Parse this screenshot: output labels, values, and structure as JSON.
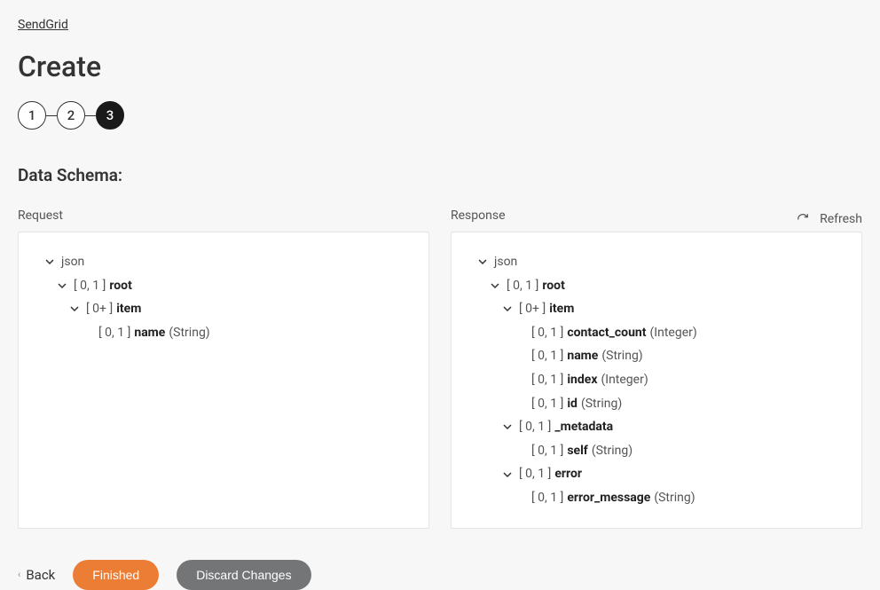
{
  "breadcrumb": "SendGrid",
  "title": "Create",
  "steps": [
    "1",
    "2",
    "3"
  ],
  "activeStep": 2,
  "sectionTitle": "Data Schema:",
  "refreshLabel": "Refresh",
  "requestLabel": "Request",
  "responseLabel": "Response",
  "occ": {
    "zeroOne": "[ 0, 1 ]",
    "zeroPlus": "[ 0+ ]"
  },
  "nodes": {
    "json": "json",
    "root": "root",
    "item": "item",
    "name": "name",
    "contact_count": "contact_count",
    "index": "index",
    "id": "id",
    "metadata": "_metadata",
    "self": "self",
    "error": "error",
    "error_message": "error_message"
  },
  "types": {
    "string": "(String)",
    "integer": "(Integer)"
  },
  "buttons": {
    "back": "Back",
    "finished": "Finished",
    "discard": "Discard Changes"
  }
}
